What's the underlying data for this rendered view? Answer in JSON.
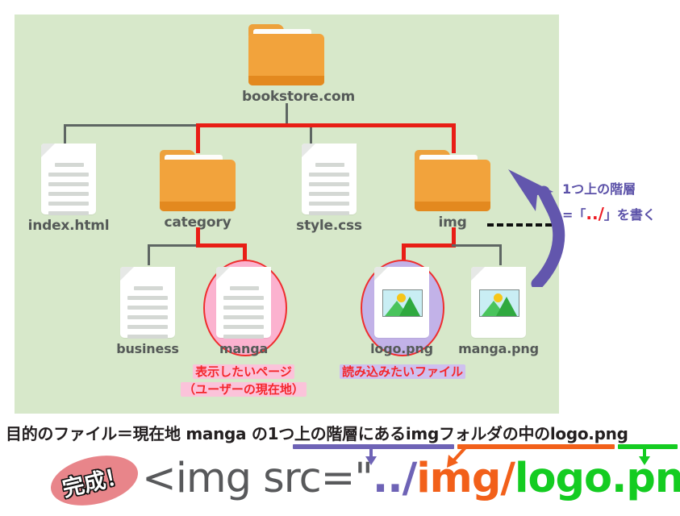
{
  "panel": {
    "background_color": "#d7e8ca"
  },
  "tree": {
    "root": {
      "name": "bookstore.com",
      "icon": "folder-icon"
    },
    "level1": [
      {
        "name": "index.html",
        "icon": "file-icon"
      },
      {
        "name": "category",
        "icon": "folder-icon"
      },
      {
        "name": "style.css",
        "icon": "file-icon"
      },
      {
        "name": "img",
        "icon": "folder-icon"
      }
    ],
    "level2": [
      {
        "name": "business",
        "icon": "file-icon"
      },
      {
        "name": "manga",
        "icon": "file-icon",
        "highlight": "pink"
      },
      {
        "name": "logo.png",
        "icon": "image-file-icon",
        "highlight": "purple"
      },
      {
        "name": "manga.png",
        "icon": "image-file-icon"
      }
    ]
  },
  "captions": {
    "manga_line1": "表示したいページ",
    "manga_line2": "（ユーザーの現在地）",
    "logo": "読み込みたいファイル"
  },
  "annotation": {
    "line1": "1つ上の階層",
    "line2_prefix": "=「",
    "line2_code": "../",
    "line2_suffix": "」を書く"
  },
  "explain": {
    "part1": "目的のファイル＝現在地 manga の1つ上の階層にある",
    "part2": "imgフォルダの中の",
    "part3": "logo.png"
  },
  "code": {
    "prefix": "<img src=\"",
    "updir": "../",
    "folder": "img/",
    "file": "logo.png",
    "suffix": "\">"
  },
  "stamp": {
    "text": "完成！"
  },
  "colors": {
    "panel_bg": "#d7e8ca",
    "folder": "#f2a33c",
    "folder_dark": "#e3891f",
    "connector_gray": "#5e6663",
    "connector_red": "#e81e16",
    "highlight_pink": "#fbb2cf",
    "highlight_purple": "#c2b2e8",
    "ellipse_stroke": "#ef2d2d",
    "annot_purple": "#5b51a8",
    "code_purple": "#6e63b6",
    "code_orange": "#f2601a",
    "code_green": "#14cc21",
    "code_gray": "#58595b",
    "caption_red": "#f4262b"
  }
}
